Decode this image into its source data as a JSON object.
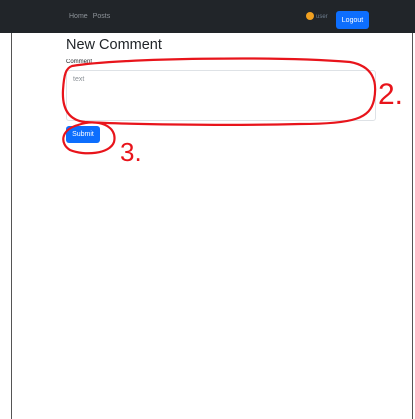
{
  "navbar": {
    "links": [
      "Home",
      "Posts"
    ],
    "user": {
      "name": "user",
      "avatar_icon": "avatar-icon"
    },
    "logout_label": "Logout",
    "background": "#212529"
  },
  "main": {
    "title": "New Comment",
    "field_label": "Comment",
    "textarea_placeholder": "text",
    "submit_label": "Submit",
    "accent": "#0d6efd"
  },
  "annotations": {
    "marks": [
      "2.",
      "3."
    ],
    "color": "#e8141b"
  }
}
